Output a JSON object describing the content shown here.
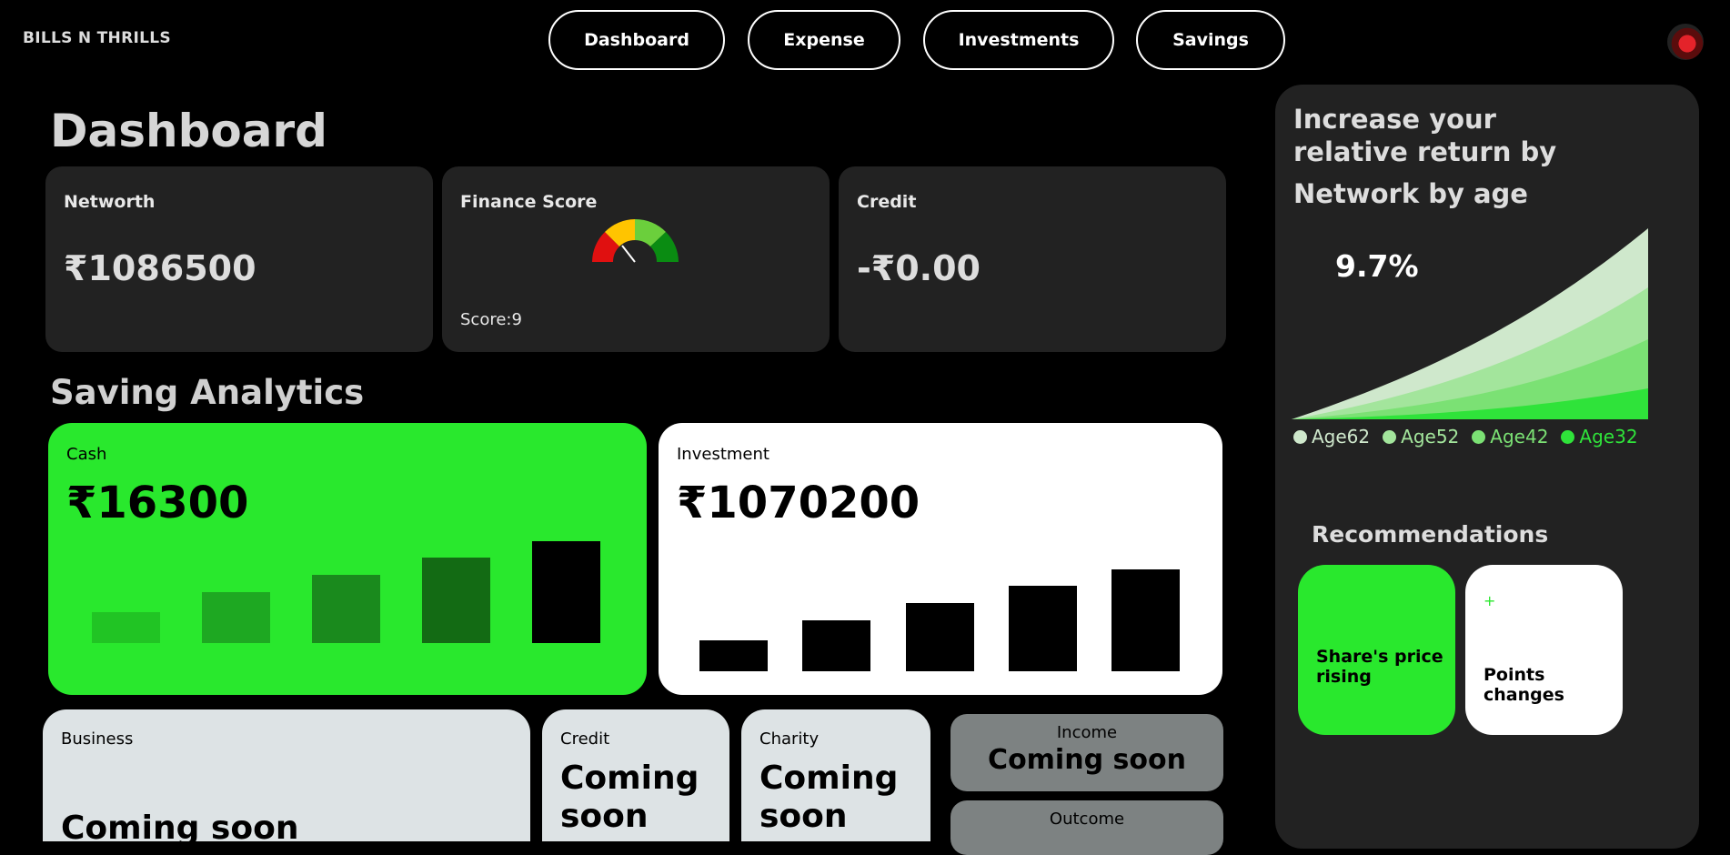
{
  "brand": "BILLS N THRILLS",
  "nav": [
    "Dashboard",
    "Expense",
    "Investments",
    "Savings"
  ],
  "page_title": "Dashboard",
  "summary": {
    "networth": {
      "label": "Networth",
      "value": "₹1086500"
    },
    "finance_score": {
      "label": "Finance Score",
      "score": "Score:9"
    },
    "credit": {
      "label": "Credit",
      "value": "-₹0.00"
    }
  },
  "saving_title": "Saving Analytics",
  "cash": {
    "label": "Cash",
    "value": "₹16300"
  },
  "investment": {
    "label": "Investment",
    "value": "₹1070200"
  },
  "lower": {
    "business": {
      "label": "Business",
      "value": "Coming soon"
    },
    "credit": {
      "label": "Credit",
      "line1": "Coming",
      "line2": "soon"
    },
    "charity": {
      "label": "Charity",
      "line1": "Coming",
      "line2": "soon"
    },
    "income": {
      "label": "Income",
      "value": "Coming soon"
    },
    "outcome": {
      "label": "Outcome"
    }
  },
  "side": {
    "title": "Increase your relative return by",
    "subtitle": "Network by age",
    "percent": "9.7%",
    "legend": [
      {
        "label": "Age62",
        "color": "#cfe8cc"
      },
      {
        "label": "Age52",
        "color": "#a3e59c"
      },
      {
        "label": "Age42",
        "color": "#7be174"
      },
      {
        "label": "Age32",
        "color": "#2fe33a"
      }
    ],
    "recommendations_title": "Recommendations",
    "rec1": "Share's price rising",
    "rec2_icon": "+",
    "rec2": "Points changes"
  },
  "colors": {
    "accent": "#29e82d",
    "card": "#222222",
    "light_card": "#dde3e5",
    "grey_pill": "#7d8282"
  }
}
